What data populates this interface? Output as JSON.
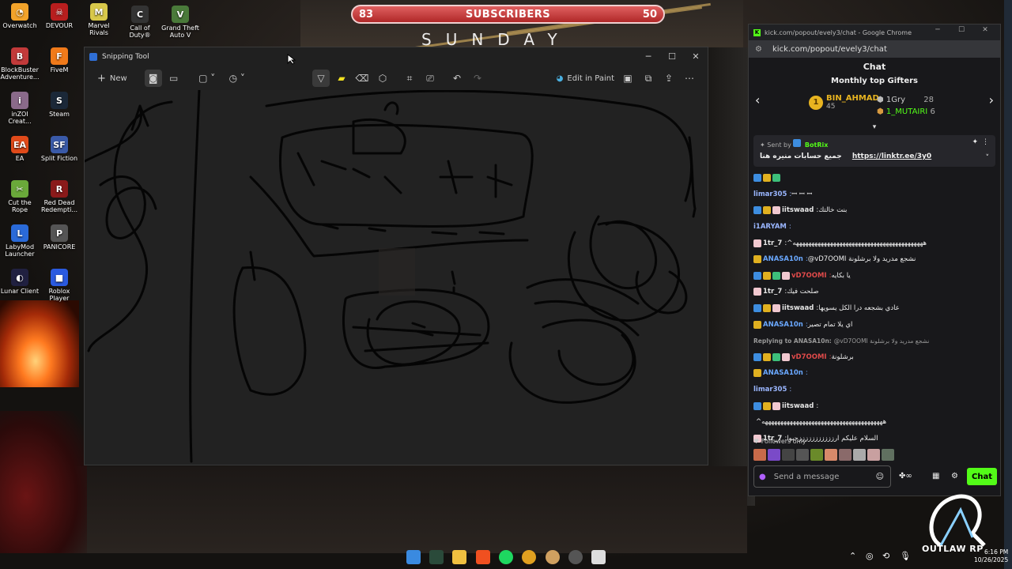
{
  "desktop": {
    "icons": [
      {
        "label": "Overwatch",
        "color": "#f2a32a",
        "glyph": "◔"
      },
      {
        "label": "DEVOUR",
        "color": "#b81e1e",
        "glyph": "☠"
      },
      {
        "label": "Marvel Rivals",
        "color": "#d8c84a",
        "glyph": "M"
      },
      {
        "label": "Call of Duty®",
        "color": "#333333",
        "glyph": "C"
      },
      {
        "label": "Grand Theft Auto V",
        "color": "#4a7a3a",
        "glyph": "V"
      },
      {
        "label": "BlockBuster Adventure...",
        "color": "#c23a3a",
        "glyph": "B"
      },
      {
        "label": "FiveM",
        "color": "#f07a1a",
        "glyph": "F"
      },
      {
        "label": "inZOI Creat...",
        "color": "#8a6a8a",
        "glyph": "i"
      },
      {
        "label": "Steam",
        "color": "#1b2838",
        "glyph": "S"
      },
      {
        "label": "EA",
        "color": "#e04a1a",
        "glyph": "EA"
      },
      {
        "label": "Split Fiction",
        "color": "#3a5aa8",
        "glyph": "SF"
      },
      {
        "label": "Cut the Rope",
        "color": "#6aa83a",
        "glyph": "✂"
      },
      {
        "label": "Red Dead Redempti...",
        "color": "#8a1a1a",
        "glyph": "R"
      },
      {
        "label": "LabyMod Launcher",
        "color": "#2a6ad8",
        "glyph": "L"
      },
      {
        "label": "PANICORE",
        "color": "#555555",
        "glyph": "P"
      },
      {
        "label": "Lunar Client",
        "color": "#202040",
        "glyph": "◐"
      },
      {
        "label": "Roblox Player",
        "color": "#2a5ae0",
        "glyph": "■"
      }
    ]
  },
  "overlay": {
    "sub_left": "83",
    "sub_label": "SUBSCRIBERS",
    "sub_right": "50",
    "day_text": "SUNDAY"
  },
  "snipping_tool": {
    "title": "Snipping Tool",
    "new_label": "New",
    "edit_in_paint_label": "Edit in Paint"
  },
  "chrome": {
    "title": "kick.com/popout/evely3/chat - Google Chrome",
    "url": "kick.com/popout/evely3/chat",
    "chat_header": "Chat",
    "gifters_title": "Monthly top Gifters",
    "gifters": [
      {
        "rank": "1",
        "name": "BIN_AHMAD",
        "count": "45"
      },
      {
        "name": "1Gry",
        "count": "28"
      },
      {
        "name": "1_MUTAIRI",
        "count": "6"
      }
    ],
    "pinned": {
      "sent_by_label": "Sent by",
      "sender": "BotRix",
      "message": "جميع حسابات منيره هنا",
      "link": "https://linktr.ee/3y0"
    },
    "messages": [
      {
        "user": "",
        "color": "#ffffff",
        "text": "",
        "badges": [
          "blue",
          "gold",
          "green"
        ]
      },
      {
        "user": "limar305",
        "color": "#9ab6ff",
        "text": "ꟷ ꟷ ꟷ",
        "badges": []
      },
      {
        "user": "iitswaad",
        "color": "#e6e6e6",
        "text": "بنت خالتك",
        "badges": [
          "blue",
          "gold",
          "pink"
        ]
      },
      {
        "user": "i1ARYAM",
        "color": "#9ab6ff",
        "text": "",
        "badges": []
      },
      {
        "user": "1tr_7",
        "color": "#e6e6e6",
        "text": "^ههههههههههههههههههههههههههههههههههههههههههه",
        "badges": [
          "pink"
        ]
      },
      {
        "user": "ANASA10n",
        "color": "#6aa8ff",
        "text": "@vD7OOMI نشجع مدريد ولا برشلونة",
        "badges": [
          "gold"
        ]
      },
      {
        "user": "vD7OOMI",
        "color": "#e04a4a",
        "text": "يا بكايه",
        "badges": [
          "blue",
          "gold",
          "green",
          "pink"
        ]
      },
      {
        "user": "1tr_7",
        "color": "#e6e6e6",
        "text": "صلحت فيك",
        "badges": [
          "pink"
        ]
      },
      {
        "user": "iitswaad",
        "color": "#e6e6e6",
        "text": "عادي بشجعه درا الكل يسويها",
        "badges": [
          "blue",
          "gold",
          "pink"
        ]
      },
      {
        "user": "ANASA10n",
        "color": "#6aa8ff",
        "text": "اي يلا تمام تصير",
        "badges": [
          "gold"
        ]
      },
      {
        "user": "Replying to ANASA10n:",
        "color": "#999999",
        "text": "@vD7OOMI نشجع مدريد ولا برشلونة",
        "badges": [],
        "reply": true
      },
      {
        "user": "vD7OOMI",
        "color": "#e04a4a",
        "text": "برشلونة",
        "badges": [
          "blue",
          "gold",
          "green",
          "pink"
        ]
      },
      {
        "user": "ANASA10n",
        "color": "#6aa8ff",
        "text": "",
        "badges": [
          "gold"
        ]
      },
      {
        "user": "limar305",
        "color": "#9ab6ff",
        "text": "",
        "badges": []
      },
      {
        "user": "iitswaad",
        "color": "#e6e6e6",
        "text": "",
        "badges": [
          "blue",
          "gold",
          "pink"
        ]
      },
      {
        "user": "",
        "color": "#e6e6e6",
        "text": "^هههههههههههههههههههههههههههههههههههههههه",
        "badges": []
      },
      {
        "user": "1tr_7",
        "color": "#e6e6e6",
        "text": "السلام عليكم ارزززززززززززحبوا",
        "badges": [
          "pink"
        ]
      }
    ],
    "followers_only": "Followers only",
    "input_placeholder": "Send a message",
    "chat_button": "Chat"
  },
  "taskbar": {
    "time": "6:16 PM",
    "date": "10/26/2025",
    "outlaw_text": "OUTLAW RP"
  }
}
